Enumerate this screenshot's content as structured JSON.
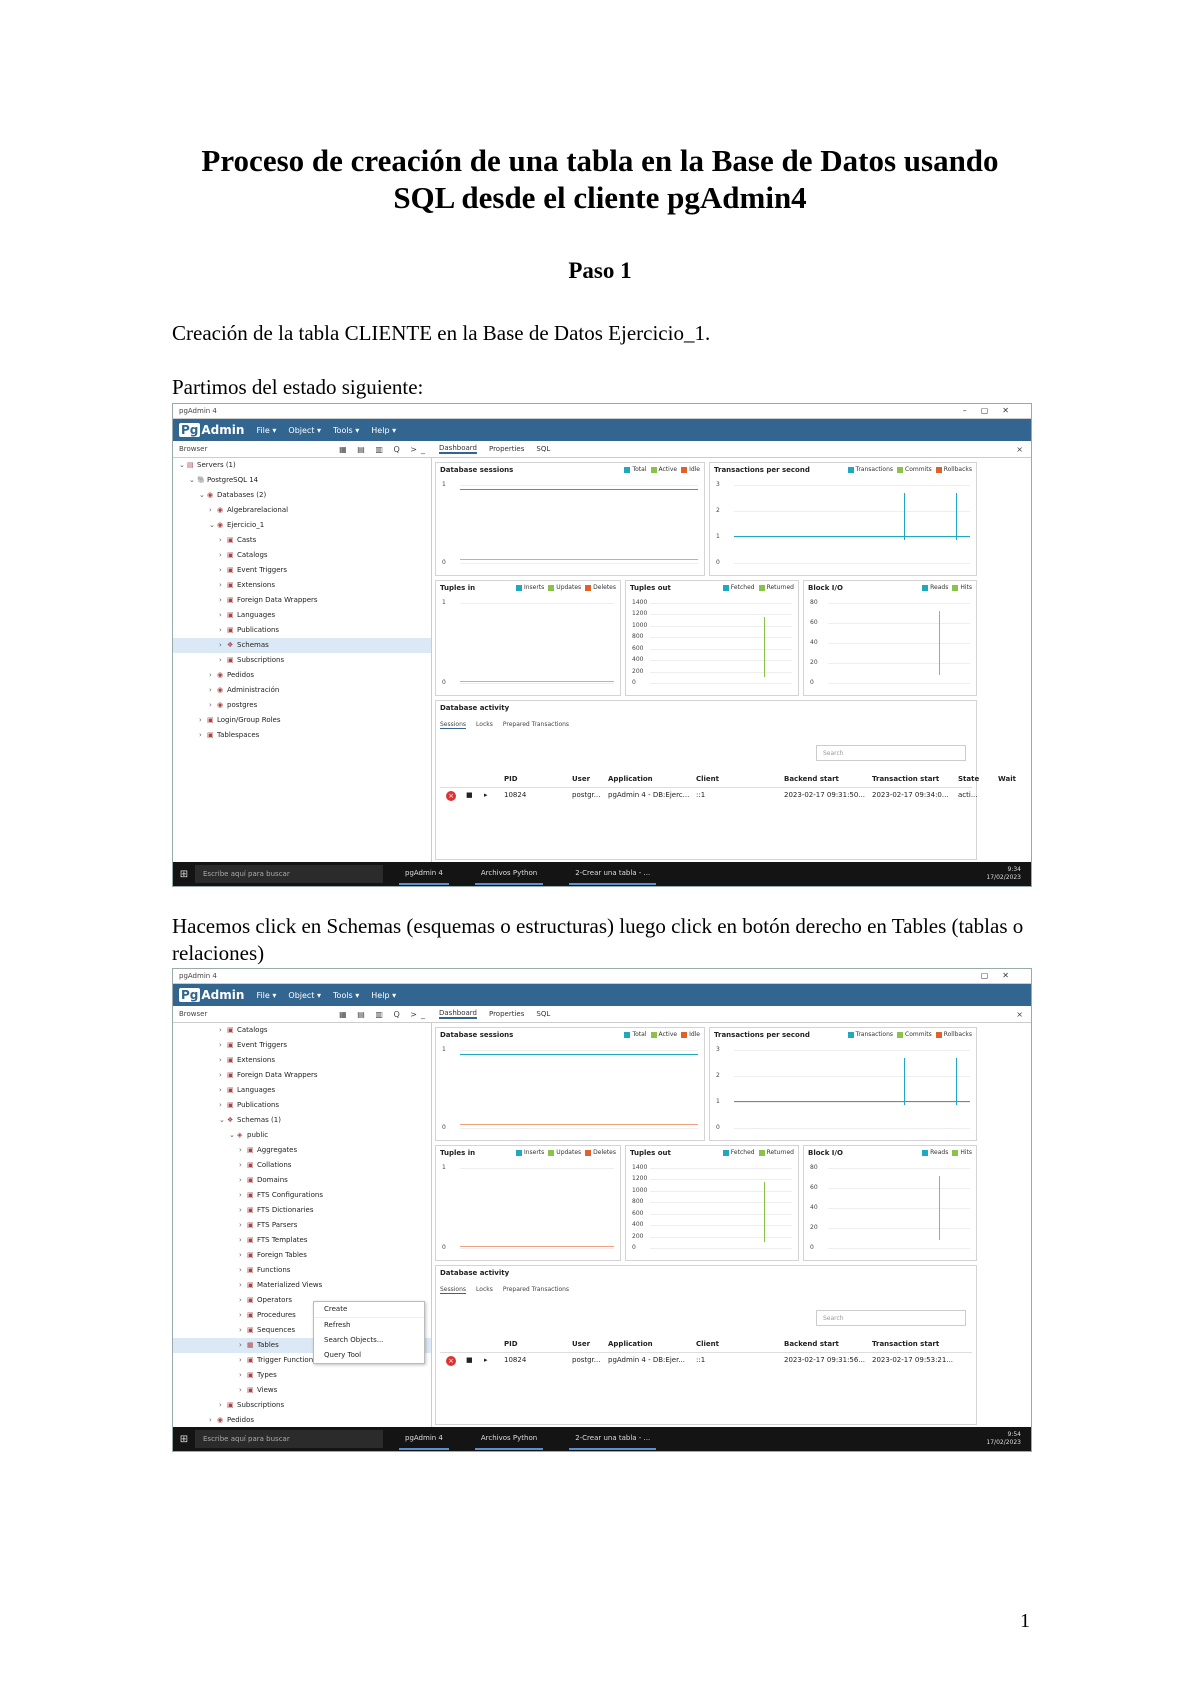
{
  "document": {
    "title_line1": "Proceso de creación de una tabla en la Base de Datos usando",
    "title_line2": "SQL desde el cliente pgAdmin4",
    "step": "Paso 1",
    "para1": "Creación de la tabla CLIENTE en la Base de Datos Ejercicio_1.",
    "para2": "Partimos del estado siguiente:",
    "para3": "Hacemos click en Schemas (esquemas o estructuras)  luego click en botón derecho en Tables (tablas o relaciones)",
    "page_number": "1"
  },
  "app": {
    "window_title": "pgAdmin 4",
    "logo_prefix": "Pg",
    "logo_suffix": "Admin",
    "menu": [
      "File ▾",
      "Object ▾",
      "Tools ▾",
      "Help ▾"
    ],
    "browser_label": "Browser",
    "toolbar_icons": "▦ ▤ ▥ Q >_",
    "tabs": [
      "Dashboard",
      "Properties",
      "SQL"
    ],
    "close": "×"
  },
  "shot1": {
    "tree": [
      {
        "label": "Servers (1)",
        "depth": 0,
        "tw": "⌄",
        "ti": "▤"
      },
      {
        "label": "PostgreSQL 14",
        "depth": 1,
        "tw": "⌄",
        "ti": "🐘"
      },
      {
        "label": "Databases (2)",
        "depth": 2,
        "tw": "⌄",
        "ti": "◉"
      },
      {
        "label": "Algebrarelacional",
        "depth": 3,
        "tw": "›",
        "ti": "◉"
      },
      {
        "label": "Ejercicio_1",
        "depth": 3,
        "tw": "⌄",
        "ti": "◉"
      },
      {
        "label": "Casts",
        "depth": 4,
        "tw": "›",
        "ti": "▣"
      },
      {
        "label": "Catalogs",
        "depth": 4,
        "tw": "›",
        "ti": "▣"
      },
      {
        "label": "Event Triggers",
        "depth": 4,
        "tw": "›",
        "ti": "▣"
      },
      {
        "label": "Extensions",
        "depth": 4,
        "tw": "›",
        "ti": "▣"
      },
      {
        "label": "Foreign Data Wrappers",
        "depth": 4,
        "tw": "›",
        "ti": "▣"
      },
      {
        "label": "Languages",
        "depth": 4,
        "tw": "›",
        "ti": "▣"
      },
      {
        "label": "Publications",
        "depth": 4,
        "tw": "›",
        "ti": "▣"
      },
      {
        "label": "Schemas",
        "depth": 4,
        "tw": "›",
        "ti": "❖",
        "selected": true
      },
      {
        "label": "Subscriptions",
        "depth": 4,
        "tw": "›",
        "ti": "▣"
      },
      {
        "label": "Pedidos",
        "depth": 3,
        "tw": "›",
        "ti": "◉"
      },
      {
        "label": "Administración",
        "depth": 3,
        "tw": "›",
        "ti": "◉"
      },
      {
        "label": "postgres",
        "depth": 3,
        "tw": "›",
        "ti": "◉"
      },
      {
        "label": "Login/Group Roles",
        "depth": 2,
        "tw": "›",
        "ti": "▣"
      },
      {
        "label": "Tablespaces",
        "depth": 2,
        "tw": "›",
        "ti": "▣"
      }
    ],
    "panels": {
      "sessions": {
        "title": "Database sessions",
        "legend": [
          "Total",
          "Active",
          "Idle"
        ],
        "y_ticks": [
          "1",
          "0"
        ]
      },
      "tps": {
        "title": "Transactions per second",
        "legend": [
          "Transactions",
          "Commits",
          "Rollbacks"
        ],
        "y_ticks": [
          "3",
          "2",
          "1",
          "0"
        ]
      },
      "tuples_in": {
        "title": "Tuples in",
        "legend": [
          "Inserts",
          "Updates",
          "Deletes"
        ],
        "y_ticks": [
          "1",
          "0"
        ]
      },
      "tuples_out": {
        "title": "Tuples out",
        "legend": [
          "Fetched",
          "Returned"
        ],
        "y_ticks": [
          "1400",
          "1200",
          "1000",
          "800",
          "600",
          "400",
          "200",
          "0"
        ]
      },
      "block_io": {
        "title": "Block I/O",
        "legend": [
          "Reads",
          "Hits"
        ],
        "y_ticks": [
          "80",
          "60",
          "40",
          "20",
          "0"
        ]
      }
    },
    "activity": {
      "title": "Database activity",
      "tabs": [
        "Sessions",
        "Locks",
        "Prepared Transactions"
      ],
      "search_placeholder": "Search",
      "headers": [
        "PID",
        "User",
        "Application",
        "Client",
        "Backend start",
        "Transaction start",
        "State",
        "Wait"
      ],
      "row": [
        "10824",
        "postgr...",
        "pgAdmin 4 - DB:Ejerc...",
        "::1",
        "2023-02-17 09:31:50...",
        "2023-02-17 09:34:0...",
        "acti..."
      ]
    },
    "taskbar": {
      "search": "Escribe aquí para buscar",
      "apps": [
        "pgAdmin 4",
        "Archivos Python",
        "2-Crear una tabla - ..."
      ],
      "clock_time": "9:34",
      "clock_date": "17/02/2023"
    }
  },
  "shot2": {
    "tree": [
      {
        "label": "Catalogs",
        "depth": 4,
        "tw": "›",
        "ti": "▣"
      },
      {
        "label": "Event Triggers",
        "depth": 4,
        "tw": "›",
        "ti": "▣"
      },
      {
        "label": "Extensions",
        "depth": 4,
        "tw": "›",
        "ti": "▣"
      },
      {
        "label": "Foreign Data Wrappers",
        "depth": 4,
        "tw": "›",
        "ti": "▣"
      },
      {
        "label": "Languages",
        "depth": 4,
        "tw": "›",
        "ti": "▣"
      },
      {
        "label": "Publications",
        "depth": 4,
        "tw": "›",
        "ti": "▣"
      },
      {
        "label": "Schemas (1)",
        "depth": 4,
        "tw": "⌄",
        "ti": "❖"
      },
      {
        "label": "public",
        "depth": 5,
        "tw": "⌄",
        "ti": "◈"
      },
      {
        "label": "Aggregates",
        "depth": 6,
        "tw": "›",
        "ti": "▣"
      },
      {
        "label": "Collations",
        "depth": 6,
        "tw": "›",
        "ti": "▣"
      },
      {
        "label": "Domains",
        "depth": 6,
        "tw": "›",
        "ti": "▣"
      },
      {
        "label": "FTS Configurations",
        "depth": 6,
        "tw": "›",
        "ti": "▣"
      },
      {
        "label": "FTS Dictionaries",
        "depth": 6,
        "tw": "›",
        "ti": "▣"
      },
      {
        "label": "FTS Parsers",
        "depth": 6,
        "tw": "›",
        "ti": "▣"
      },
      {
        "label": "FTS Templates",
        "depth": 6,
        "tw": "›",
        "ti": "▣"
      },
      {
        "label": "Foreign Tables",
        "depth": 6,
        "tw": "›",
        "ti": "▣"
      },
      {
        "label": "Functions",
        "depth": 6,
        "tw": "›",
        "ti": "▣"
      },
      {
        "label": "Materialized Views",
        "depth": 6,
        "tw": "›",
        "ti": "▣"
      },
      {
        "label": "Operators",
        "depth": 6,
        "tw": "›",
        "ti": "▣"
      },
      {
        "label": "Procedures",
        "depth": 6,
        "tw": "›",
        "ti": "▣"
      },
      {
        "label": "Sequences",
        "depth": 6,
        "tw": "›",
        "ti": "▣"
      },
      {
        "label": "Tables",
        "depth": 6,
        "tw": "›",
        "ti": "▦",
        "selected": true
      },
      {
        "label": "Trigger Functions",
        "depth": 6,
        "tw": "›",
        "ti": "▣"
      },
      {
        "label": "Types",
        "depth": 6,
        "tw": "›",
        "ti": "▣"
      },
      {
        "label": "Views",
        "depth": 6,
        "tw": "›",
        "ti": "▣"
      },
      {
        "label": "Subscriptions",
        "depth": 4,
        "tw": "›",
        "ti": "▣"
      },
      {
        "label": "Pedidos",
        "depth": 3,
        "tw": "›",
        "ti": "◉"
      }
    ],
    "context_menu": [
      "Create",
      "Refresh",
      "Search Objects...",
      "Query Tool"
    ],
    "panels": {
      "sessions": {
        "title": "Database sessions",
        "legend": [
          "Total",
          "Active",
          "Idle"
        ],
        "y_ticks": [
          "1",
          "0"
        ]
      },
      "tps": {
        "title": "Transactions per second",
        "legend": [
          "Transactions",
          "Commits",
          "Rollbacks"
        ],
        "y_ticks": [
          "3",
          "2",
          "1",
          "0"
        ]
      },
      "tuples_in": {
        "title": "Tuples in",
        "legend": [
          "Inserts",
          "Updates",
          "Deletes"
        ],
        "y_ticks": [
          "1",
          "0"
        ]
      },
      "tuples_out": {
        "title": "Tuples out",
        "legend": [
          "Fetched",
          "Returned"
        ],
        "y_ticks": [
          "1400",
          "1200",
          "1000",
          "800",
          "600",
          "400",
          "200",
          "0"
        ]
      },
      "block_io": {
        "title": "Block I/O",
        "legend": [
          "Reads",
          "Hits"
        ],
        "y_ticks": [
          "80",
          "60",
          "40",
          "20",
          "0"
        ]
      }
    },
    "activity": {
      "title": "Database activity",
      "tabs": [
        "Sessions",
        "Locks",
        "Prepared Transactions"
      ],
      "search_placeholder": "Search",
      "headers": [
        "PID",
        "User",
        "Application",
        "Client",
        "Backend start",
        "Transaction start"
      ],
      "row": [
        "10824",
        "postgr...",
        "pgAdmin 4 - DB:Ejer...",
        "::1",
        "2023-02-17 09:31:56...",
        "2023-02-17 09:53:21..."
      ]
    },
    "taskbar": {
      "search": "Escribe aquí para buscar",
      "apps": [
        "pgAdmin 4",
        "Archivos Python",
        "2-Crear una tabla - ..."
      ],
      "clock_time": "9:54",
      "clock_date": "17/02/2023"
    }
  },
  "colors": {
    "pg_blue": "#326690",
    "teal": "#1fa8c0",
    "green": "#8bc34a",
    "orange": "#e0622a",
    "selection": "#dbe8f5"
  }
}
